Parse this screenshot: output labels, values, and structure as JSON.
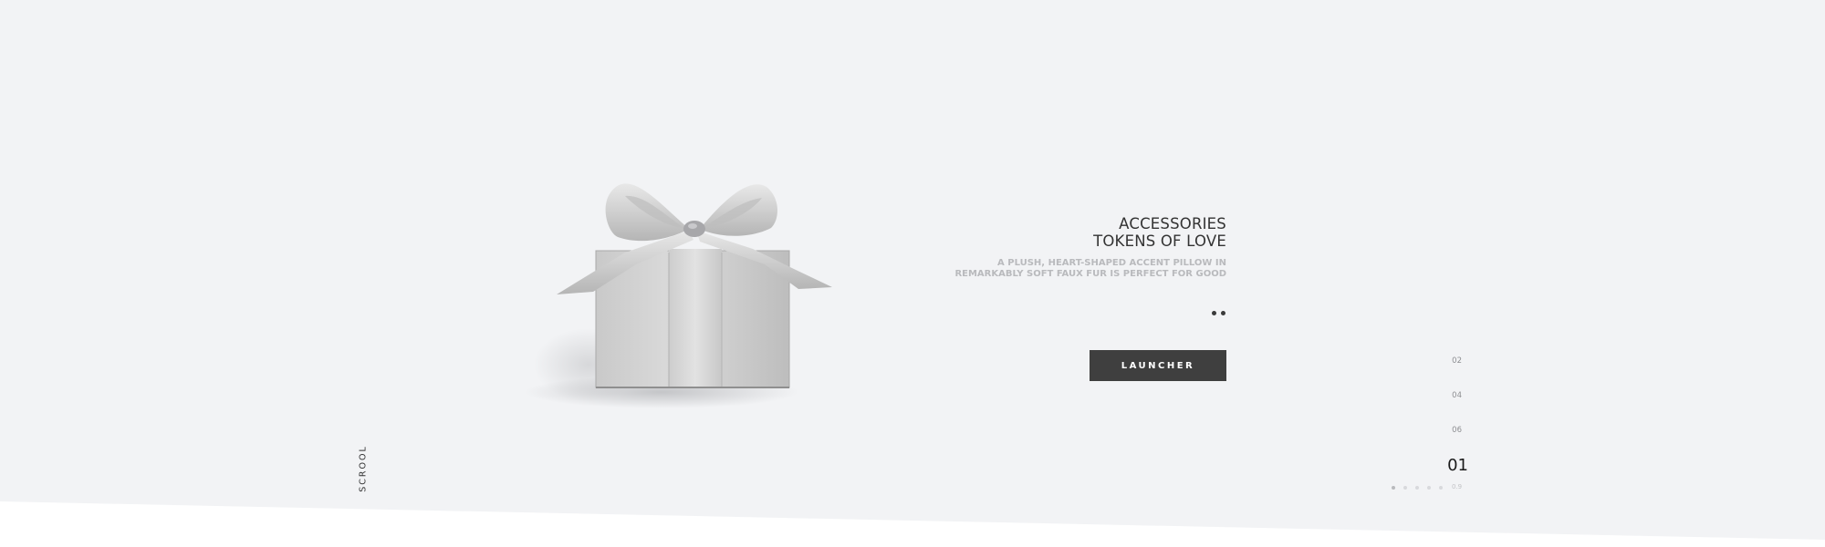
{
  "hero": {
    "image_alt": "gift-box-with-silver-ribbon",
    "title_line1": "ACCESSORIES",
    "title_line2": "TOKENS OF LOVE",
    "description_line1": "A PLUSH, HEART-SHAPED ACCENT PILLOW IN",
    "description_line2": "REMARKABLY SOFT FAUX FUR IS PERFECT FOR GOOD",
    "button_label": "LAUNCHER",
    "scroll_label": "SCROOL"
  },
  "slider": {
    "numbers": [
      "02",
      "04",
      "06"
    ],
    "current": "01",
    "total": "0.9",
    "dot_count": 5,
    "active_dot": 0
  },
  "colors": {
    "hero_background": "#f2f3f5",
    "button_background": "#3f3f3f",
    "button_text": "#ffffff",
    "title": "#333333",
    "description": "#b9babd"
  }
}
